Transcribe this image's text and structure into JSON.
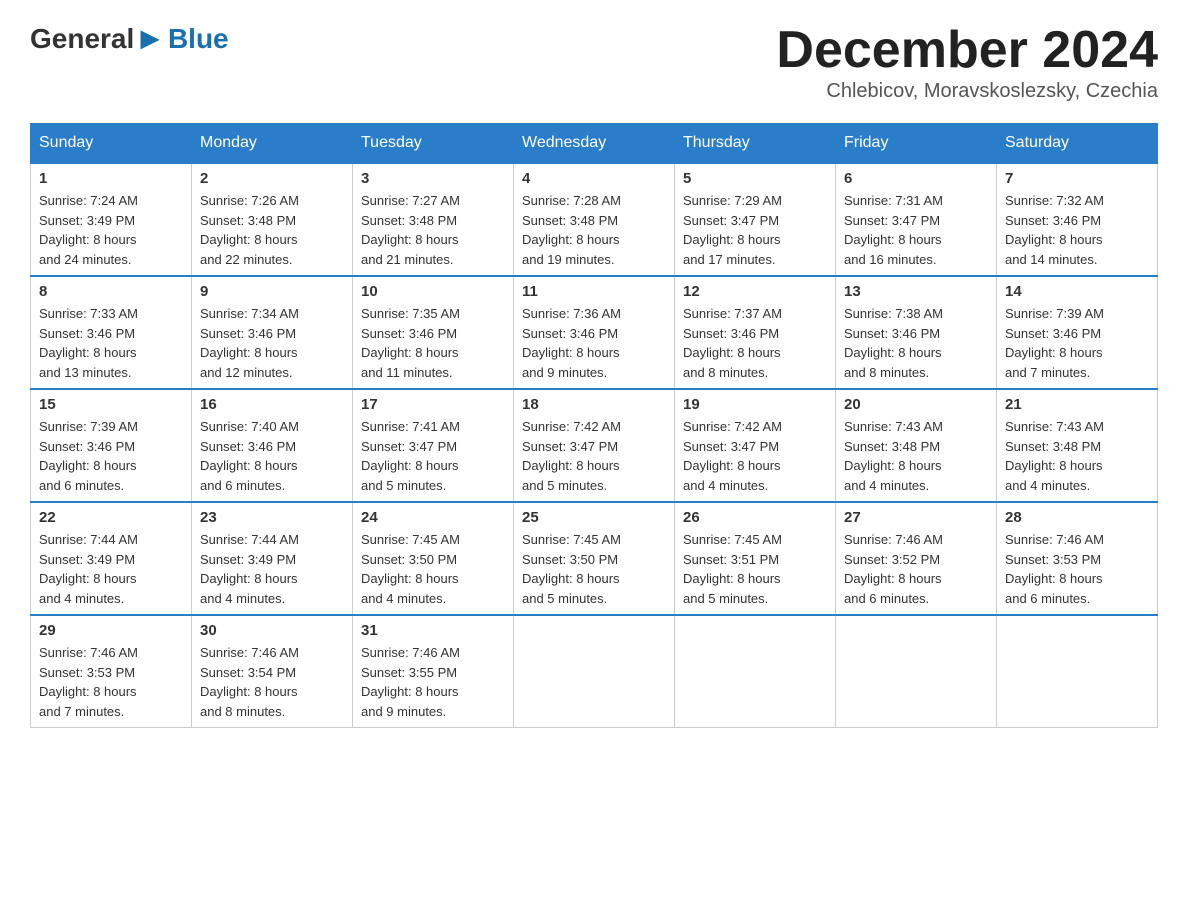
{
  "header": {
    "logo_general": "General",
    "logo_blue": "Blue",
    "month_title": "December 2024",
    "location": "Chlebicov, Moravskoslezsky, Czechia"
  },
  "days_of_week": [
    "Sunday",
    "Monday",
    "Tuesday",
    "Wednesday",
    "Thursday",
    "Friday",
    "Saturday"
  ],
  "weeks": [
    [
      {
        "num": "1",
        "sunrise": "7:24 AM",
        "sunset": "3:49 PM",
        "daylight": "8 hours and 24 minutes."
      },
      {
        "num": "2",
        "sunrise": "7:26 AM",
        "sunset": "3:48 PM",
        "daylight": "8 hours and 22 minutes."
      },
      {
        "num": "3",
        "sunrise": "7:27 AM",
        "sunset": "3:48 PM",
        "daylight": "8 hours and 21 minutes."
      },
      {
        "num": "4",
        "sunrise": "7:28 AM",
        "sunset": "3:48 PM",
        "daylight": "8 hours and 19 minutes."
      },
      {
        "num": "5",
        "sunrise": "7:29 AM",
        "sunset": "3:47 PM",
        "daylight": "8 hours and 17 minutes."
      },
      {
        "num": "6",
        "sunrise": "7:31 AM",
        "sunset": "3:47 PM",
        "daylight": "8 hours and 16 minutes."
      },
      {
        "num": "7",
        "sunrise": "7:32 AM",
        "sunset": "3:46 PM",
        "daylight": "8 hours and 14 minutes."
      }
    ],
    [
      {
        "num": "8",
        "sunrise": "7:33 AM",
        "sunset": "3:46 PM",
        "daylight": "8 hours and 13 minutes."
      },
      {
        "num": "9",
        "sunrise": "7:34 AM",
        "sunset": "3:46 PM",
        "daylight": "8 hours and 12 minutes."
      },
      {
        "num": "10",
        "sunrise": "7:35 AM",
        "sunset": "3:46 PM",
        "daylight": "8 hours and 11 minutes."
      },
      {
        "num": "11",
        "sunrise": "7:36 AM",
        "sunset": "3:46 PM",
        "daylight": "8 hours and 9 minutes."
      },
      {
        "num": "12",
        "sunrise": "7:37 AM",
        "sunset": "3:46 PM",
        "daylight": "8 hours and 8 minutes."
      },
      {
        "num": "13",
        "sunrise": "7:38 AM",
        "sunset": "3:46 PM",
        "daylight": "8 hours and 8 minutes."
      },
      {
        "num": "14",
        "sunrise": "7:39 AM",
        "sunset": "3:46 PM",
        "daylight": "8 hours and 7 minutes."
      }
    ],
    [
      {
        "num": "15",
        "sunrise": "7:39 AM",
        "sunset": "3:46 PM",
        "daylight": "8 hours and 6 minutes."
      },
      {
        "num": "16",
        "sunrise": "7:40 AM",
        "sunset": "3:46 PM",
        "daylight": "8 hours and 6 minutes."
      },
      {
        "num": "17",
        "sunrise": "7:41 AM",
        "sunset": "3:47 PM",
        "daylight": "8 hours and 5 minutes."
      },
      {
        "num": "18",
        "sunrise": "7:42 AM",
        "sunset": "3:47 PM",
        "daylight": "8 hours and 5 minutes."
      },
      {
        "num": "19",
        "sunrise": "7:42 AM",
        "sunset": "3:47 PM",
        "daylight": "8 hours and 4 minutes."
      },
      {
        "num": "20",
        "sunrise": "7:43 AM",
        "sunset": "3:48 PM",
        "daylight": "8 hours and 4 minutes."
      },
      {
        "num": "21",
        "sunrise": "7:43 AM",
        "sunset": "3:48 PM",
        "daylight": "8 hours and 4 minutes."
      }
    ],
    [
      {
        "num": "22",
        "sunrise": "7:44 AM",
        "sunset": "3:49 PM",
        "daylight": "8 hours and 4 minutes."
      },
      {
        "num": "23",
        "sunrise": "7:44 AM",
        "sunset": "3:49 PM",
        "daylight": "8 hours and 4 minutes."
      },
      {
        "num": "24",
        "sunrise": "7:45 AM",
        "sunset": "3:50 PM",
        "daylight": "8 hours and 4 minutes."
      },
      {
        "num": "25",
        "sunrise": "7:45 AM",
        "sunset": "3:50 PM",
        "daylight": "8 hours and 5 minutes."
      },
      {
        "num": "26",
        "sunrise": "7:45 AM",
        "sunset": "3:51 PM",
        "daylight": "8 hours and 5 minutes."
      },
      {
        "num": "27",
        "sunrise": "7:46 AM",
        "sunset": "3:52 PM",
        "daylight": "8 hours and 6 minutes."
      },
      {
        "num": "28",
        "sunrise": "7:46 AM",
        "sunset": "3:53 PM",
        "daylight": "8 hours and 6 minutes."
      }
    ],
    [
      {
        "num": "29",
        "sunrise": "7:46 AM",
        "sunset": "3:53 PM",
        "daylight": "8 hours and 7 minutes."
      },
      {
        "num": "30",
        "sunrise": "7:46 AM",
        "sunset": "3:54 PM",
        "daylight": "8 hours and 8 minutes."
      },
      {
        "num": "31",
        "sunrise": "7:46 AM",
        "sunset": "3:55 PM",
        "daylight": "8 hours and 9 minutes."
      },
      null,
      null,
      null,
      null
    ]
  ],
  "labels": {
    "sunrise": "Sunrise:",
    "sunset": "Sunset:",
    "daylight": "Daylight:"
  }
}
